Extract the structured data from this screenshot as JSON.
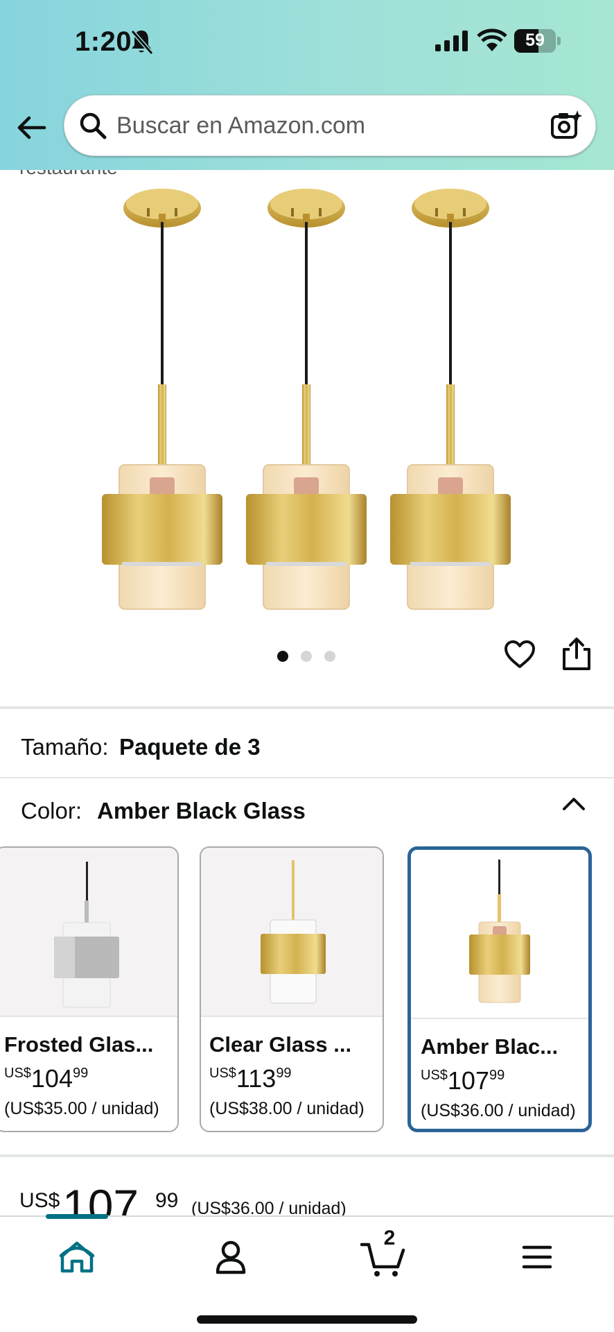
{
  "status_bar": {
    "time": "1:20",
    "battery": "59",
    "battery_level": 0.59
  },
  "search": {
    "placeholder": "Buscar en Amazon.com"
  },
  "breadcrumb": "restaurante",
  "gallery": {
    "image_count": 3,
    "active_index": 0
  },
  "size": {
    "label": "Tamaño:",
    "value": "Paquete de 3"
  },
  "color": {
    "label": "Color:",
    "value": "Amber Black Glass"
  },
  "variants": [
    {
      "name": "Frosted Glas...",
      "currency": "US$",
      "whole": "104",
      "fraction": "99",
      "unit_price": "(US$35.00 / unidad)",
      "selected": false
    },
    {
      "name": "Clear Glass ...",
      "currency": "US$",
      "whole": "113",
      "fraction": "99",
      "unit_price": "(US$38.00 / unidad)",
      "selected": false
    },
    {
      "name": "Amber Blac...",
      "currency": "US$",
      "whole": "107",
      "fraction": "99",
      "unit_price": "(US$36.00 / unidad)",
      "selected": true
    }
  ],
  "price": {
    "currency": "US$",
    "whole": "107",
    "fraction": "99",
    "unit_price": "(US$36.00 / unidad)"
  },
  "nav": {
    "cart_count": "2"
  },
  "colors": {
    "accent": "#007185",
    "selected_border": "#2a6496",
    "brass": "#c9a54a"
  }
}
